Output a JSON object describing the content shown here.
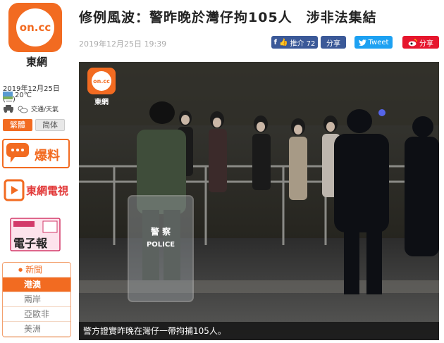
{
  "site": {
    "logo_text": "on.cc",
    "name": "東網"
  },
  "sidebar": {
    "date": "2019年12月25日 (三)",
    "temperature": "20℃",
    "traffic_weather": "交通/天氣",
    "lang_traditional": "繁體",
    "lang_simplified": "简体",
    "promo_baoliao": "爆料",
    "promo_tv": "東網電視",
    "promo_epaper": "電子報",
    "nav": [
      {
        "label": "新聞"
      },
      {
        "label": "港澳"
      },
      {
        "label": "兩岸"
      },
      {
        "label": "亞歐非"
      },
      {
        "label": "美洲"
      }
    ]
  },
  "article": {
    "title": "修例風波：警昨晚於灣仔拘105人　涉非法集結",
    "timestamp": "2019年12月25日 19:39",
    "like_label": "推介 72",
    "fb_share_label": "分享",
    "tweet_label": "Tweet",
    "weibo_label": "分享",
    "photo_caption": "警方證實昨晚在灣仔一帶拘捕105人。",
    "photo_watermark_logo": "on.cc",
    "photo_watermark_name": "東網",
    "police_shield_text": "警 察",
    "police_shield_subtext": "POLICE"
  },
  "colors": {
    "brand": "#f26b21",
    "facebook": "#3b5998",
    "twitter": "#1da1f2",
    "weibo": "#e6162d"
  }
}
